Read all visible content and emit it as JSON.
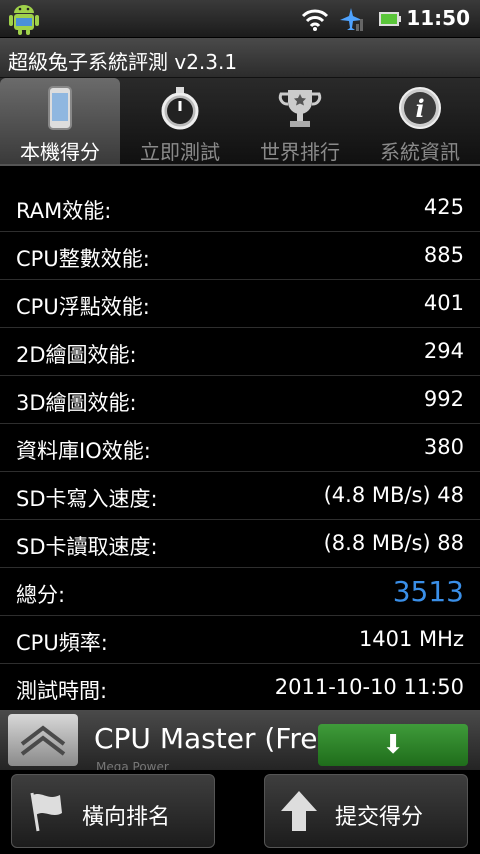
{
  "status_bar": {
    "time": "11:50",
    "icons": [
      "android-icon",
      "wifi-icon",
      "airplane-signal-icon",
      "battery-icon"
    ]
  },
  "title": "超級兔子系統評測 v2.3.1",
  "tabs": [
    {
      "label": "本機得分",
      "icon": "phone-icon",
      "active": true
    },
    {
      "label": "立即測試",
      "icon": "stopwatch-icon",
      "active": false
    },
    {
      "label": "世界排行",
      "icon": "trophy-icon",
      "active": false
    },
    {
      "label": "系統資訊",
      "icon": "info-icon",
      "active": false
    }
  ],
  "rows": [
    {
      "label": "RAM效能:",
      "value": "425"
    },
    {
      "label": "CPU整數效能:",
      "value": "885"
    },
    {
      "label": "CPU浮點效能:",
      "value": "401"
    },
    {
      "label": "2D繪圖效能:",
      "value": "294"
    },
    {
      "label": "3D繪圖效能:",
      "value": "992"
    },
    {
      "label": "資料庫IO效能:",
      "value": "380"
    },
    {
      "label": "SD卡寫入速度:",
      "value": "(4.8 MB/s)  48"
    },
    {
      "label": "SD卡讀取速度:",
      "value": "(8.8 MB/s)  88"
    },
    {
      "label": "總分:",
      "value": "3513"
    },
    {
      "label": "CPU頻率:",
      "value": "1401 MHz"
    },
    {
      "label": "測試時間:",
      "value": "2011-10-10 11:50"
    }
  ],
  "ad": {
    "name": "CPU Master (Free)",
    "sub": "Mega Power",
    "download_label": "⬇ DownLoad"
  },
  "buttons": {
    "ranking": "橫向排名",
    "submit": "提交得分"
  },
  "colors": {
    "score": "#3a8fe8",
    "download": "#2e8a29"
  }
}
